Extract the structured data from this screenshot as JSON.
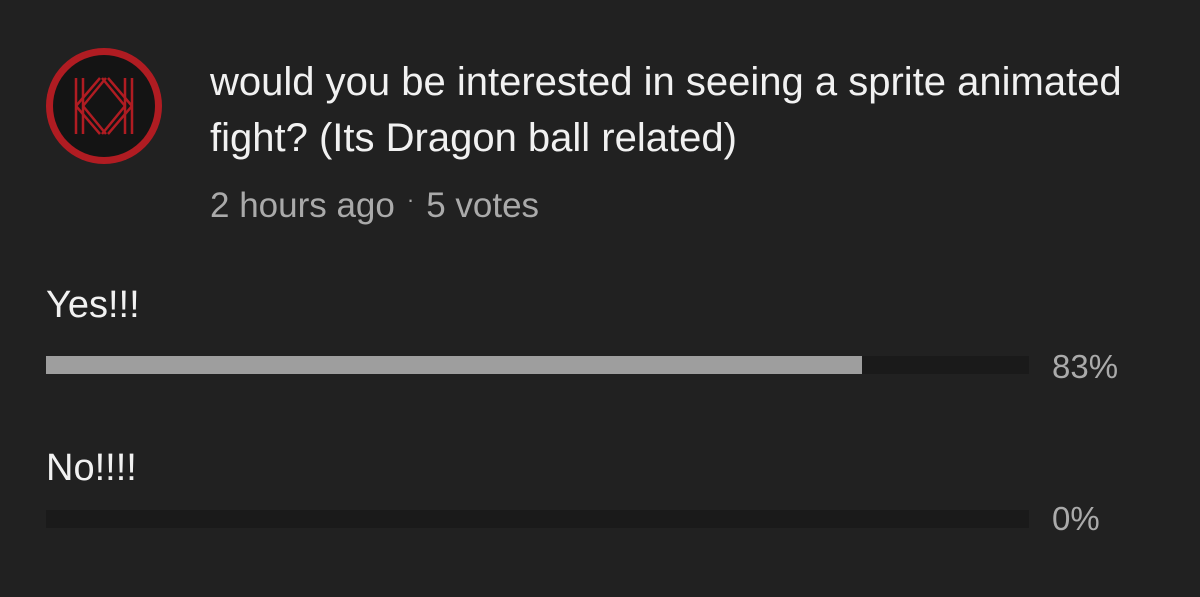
{
  "post": {
    "avatar_icon": "kk-logo-icon",
    "avatar_color": "#b01c22",
    "question": "would you be interested in seeing a sprite animated fight? (Its Dragon ball related)",
    "time": "2 hours ago",
    "separator": "·",
    "votes": "5 votes"
  },
  "poll": {
    "options": [
      {
        "label": "Yes!!!",
        "percent_text": "83%",
        "fraction": 0.83
      },
      {
        "label": "No!!!!",
        "percent_text": "0%",
        "fraction": 0.0
      }
    ],
    "bar_fill_color": "#9e9e9e",
    "bar_track_color": "#1a1a1a"
  }
}
